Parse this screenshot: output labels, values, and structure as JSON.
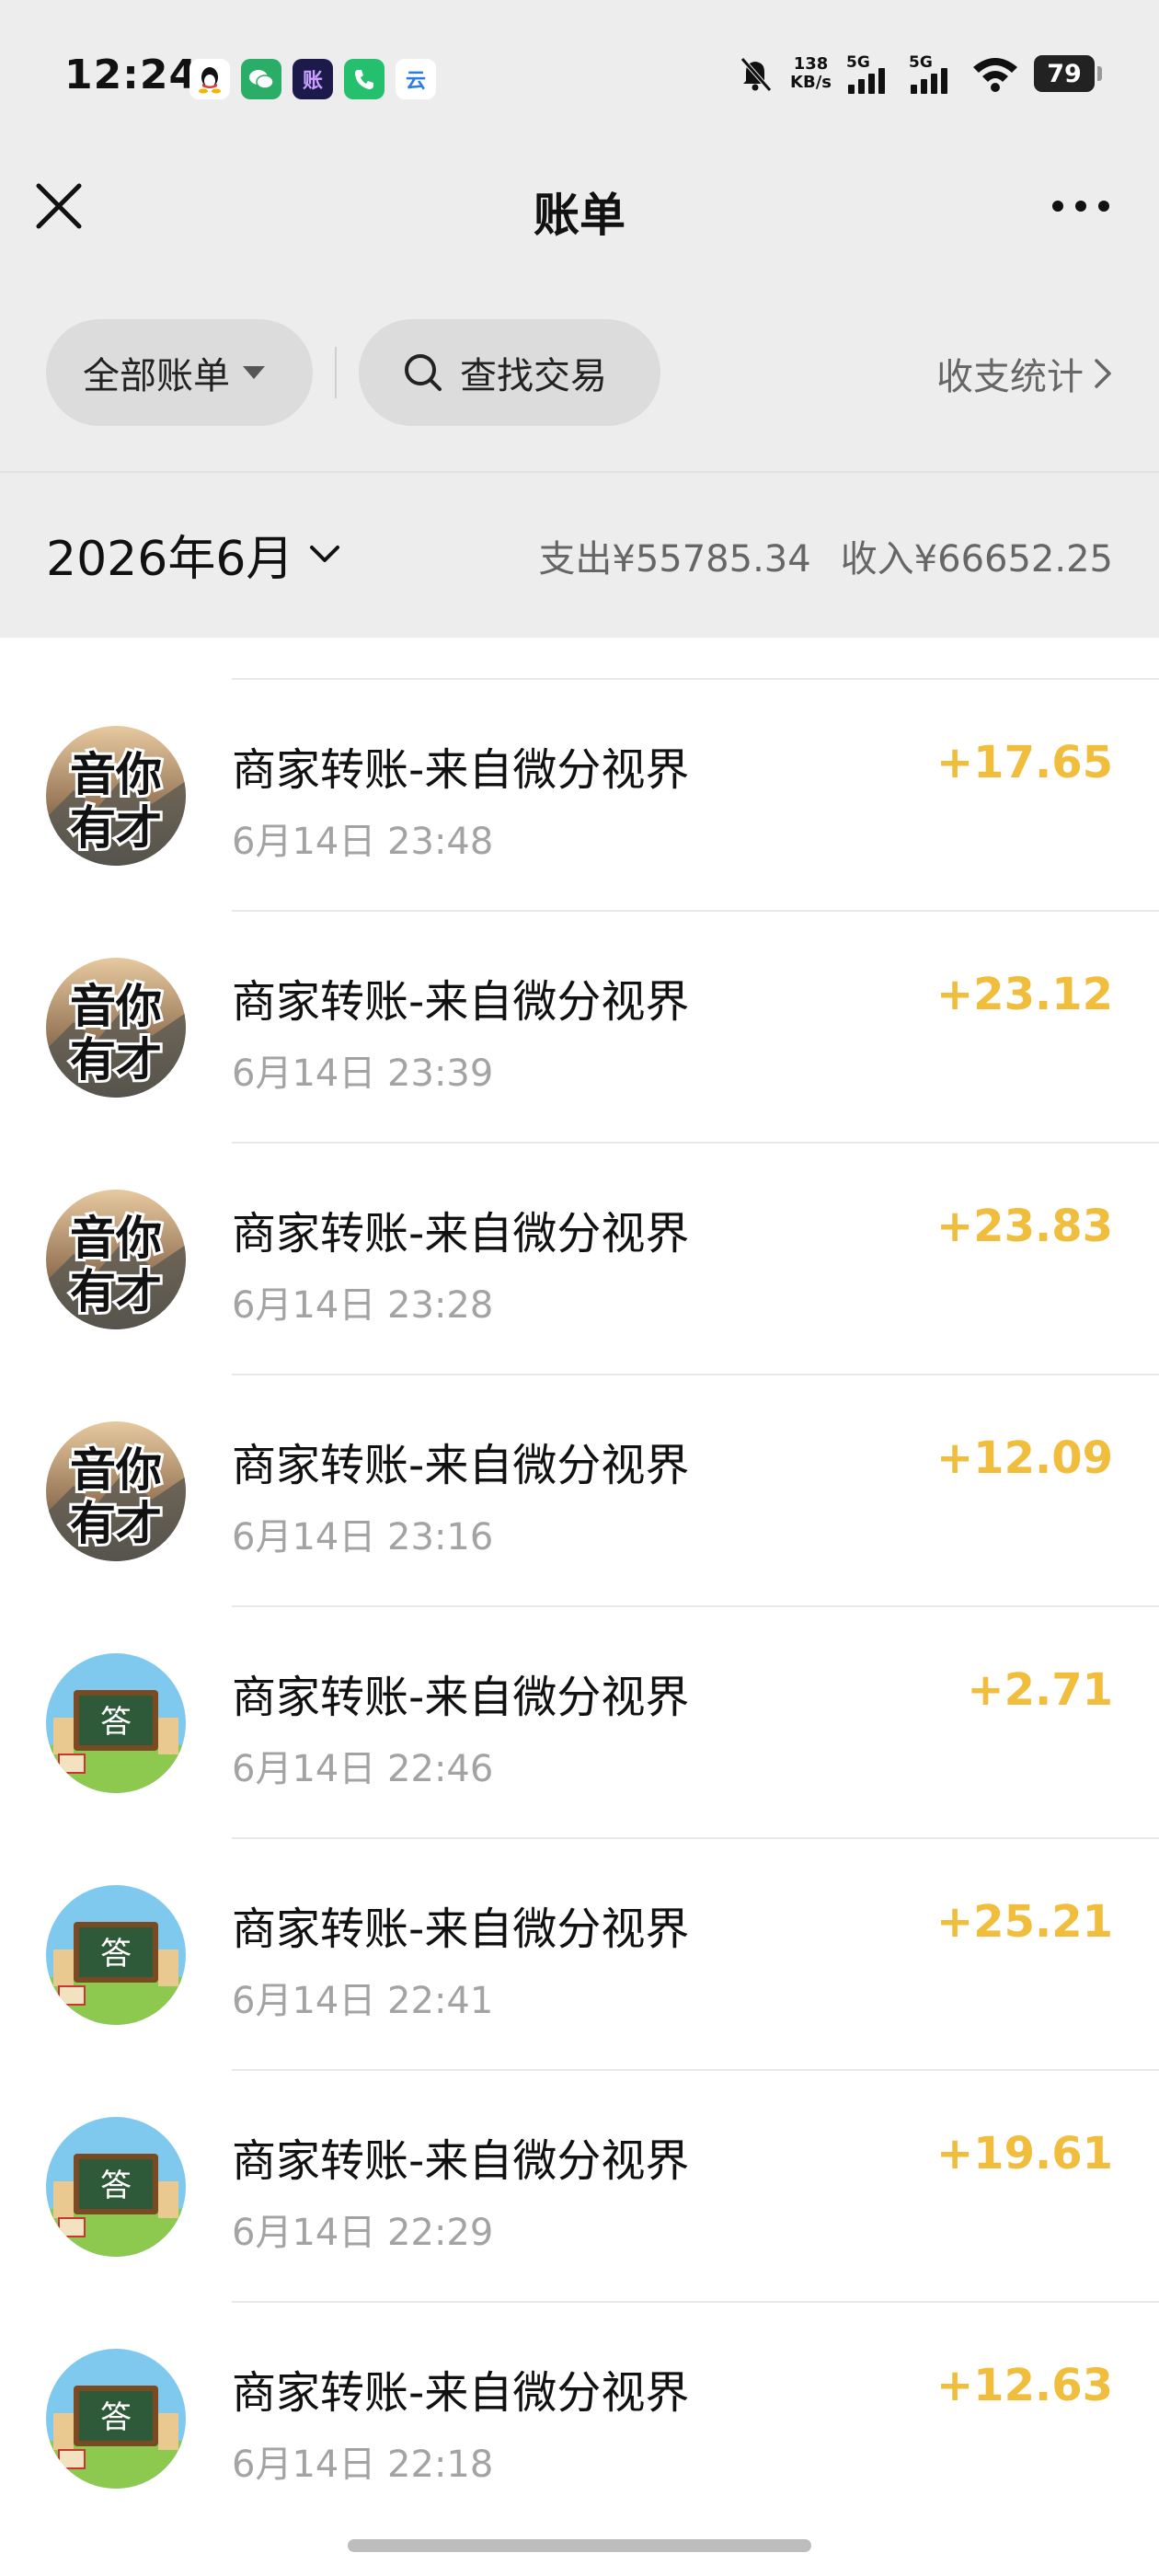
{
  "status_bar": {
    "time": "12:24",
    "net_speed_value": "138",
    "net_speed_unit": "KB/s",
    "sim1": "5G",
    "sim2": "5G",
    "battery": "79",
    "app_icons": [
      "qq-icon",
      "wechat-icon",
      "ledger-app-icon",
      "phone-app-icon",
      "cloud-app-icon"
    ],
    "ledger_app_glyph": "账",
    "cloud_app_glyph": "云"
  },
  "nav": {
    "title": "账单",
    "close_icon": "close-icon",
    "more_icon": "more-dots-icon"
  },
  "filters": {
    "all_bills_label": "全部账单",
    "search_label": "查找交易",
    "stats_label": "收支统计"
  },
  "month": {
    "label": "2026年6月",
    "expense": "支出¥55785.34",
    "income": "收入¥66652.25"
  },
  "colors": {
    "amount": "#f0bd3d",
    "page_gray": "#ededed"
  },
  "transactions": [
    {
      "title": "商家转账-来自微分视界",
      "time": "6月14日 23:48",
      "amount": "+17.65",
      "avatar": "yinni-youcai-avatar",
      "avatar_text": [
        "音你",
        "有才"
      ]
    },
    {
      "title": "商家转账-来自微分视界",
      "time": "6月14日 23:39",
      "amount": "+23.12",
      "avatar": "yinni-youcai-avatar",
      "avatar_text": [
        "音你",
        "有才"
      ]
    },
    {
      "title": "商家转账-来自微分视界",
      "time": "6月14日 23:28",
      "amount": "+23.83",
      "avatar": "yinni-youcai-avatar",
      "avatar_text": [
        "音你",
        "有才"
      ]
    },
    {
      "title": "商家转账-来自微分视界",
      "time": "6月14日 23:16",
      "amount": "+12.09",
      "avatar": "yinni-youcai-avatar",
      "avatar_text": [
        "音你",
        "有才"
      ]
    },
    {
      "title": "商家转账-来自微分视界",
      "time": "6月14日 22:46",
      "amount": "+2.71",
      "avatar": "chalkboard-answer-avatar",
      "avatar_text": [
        "答"
      ]
    },
    {
      "title": "商家转账-来自微分视界",
      "time": "6月14日 22:41",
      "amount": "+25.21",
      "avatar": "chalkboard-answer-avatar",
      "avatar_text": [
        "答"
      ]
    },
    {
      "title": "商家转账-来自微分视界",
      "time": "6月14日 22:29",
      "amount": "+19.61",
      "avatar": "chalkboard-answer-avatar",
      "avatar_text": [
        "答"
      ]
    },
    {
      "title": "商家转账-来自微分视界",
      "time": "6月14日 22:18",
      "amount": "+12.63",
      "avatar": "chalkboard-answer-avatar",
      "avatar_text": [
        "答"
      ]
    }
  ]
}
